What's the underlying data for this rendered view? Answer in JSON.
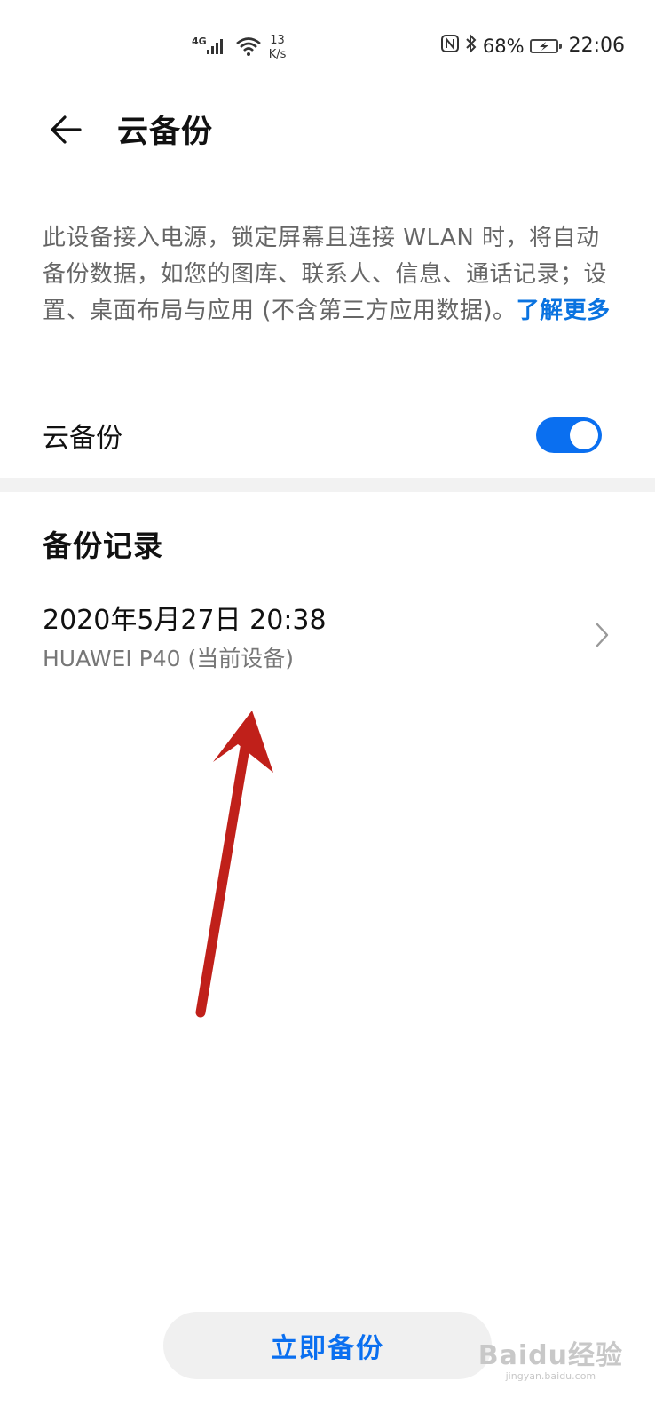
{
  "status_bar": {
    "network": "4G",
    "speed_value": "13",
    "speed_unit": "K/s",
    "battery": "68%",
    "time": "22:06"
  },
  "app_bar": {
    "title": "云备份"
  },
  "description": {
    "text": "此设备接入电源，锁定屏幕且连接 WLAN 时，将自动备份数据，如您的图库、联系人、信息、通话记录；设置、桌面布局与应用 (不含第三方应用数据)。",
    "link": "了解更多"
  },
  "toggle": {
    "label": "云备份",
    "state": "on"
  },
  "records": {
    "header": "备份记录",
    "items": [
      {
        "title": "2020年5月27日 20:38",
        "subtitle": "HUAWEI P40 (当前设备)"
      }
    ]
  },
  "actions": {
    "backup_now": "立即备份"
  },
  "watermark": {
    "logo": "Baidu经验",
    "url": "jingyan.baidu.com"
  },
  "colors": {
    "accent": "#0a6ff0",
    "annotation_arrow": "#c0201a"
  }
}
